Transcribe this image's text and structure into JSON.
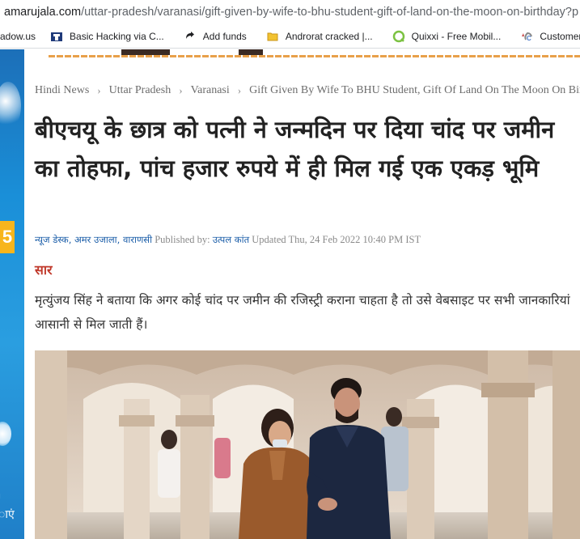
{
  "browser": {
    "url_domain": "amarujala.com",
    "url_path": "/uttar-pradesh/varanasi/gift-given-by-wife-to-bhu-student-gift-of-land-on-the-moon-on-birthday?p"
  },
  "bookmarks": [
    {
      "label": "adow.us",
      "icon": "bookmark-favicon"
    },
    {
      "label": "Basic Hacking via C...",
      "icon": "hack-favicon"
    },
    {
      "label": "Add funds",
      "icon": "add-funds-favicon"
    },
    {
      "label": "Androrat cracked |...",
      "icon": "folder-favicon"
    },
    {
      "label": "Quixxi - Free Mobil...",
      "icon": "quixxi-favicon"
    },
    {
      "label": "Customer Service",
      "icon": "customer-service-favicon"
    }
  ],
  "left_ad": {
    "badge": "5",
    "line1": "ı",
    "line2": "ाएं"
  },
  "breadcrumb": {
    "items": [
      "Hindi News",
      "Uttar Pradesh",
      "Varanasi",
      "Gift Given By Wife To BHU Student, Gift Of Land On The Moon On Birthday"
    ],
    "separator": "›"
  },
  "article": {
    "headline": "बीएचयू के छात्र को पत्नी ने जन्मदिन पर दिया चांद पर जमीन का तोहफा, पांच हजार रुपये में ही मिल गई एक एकड़ भूमि",
    "byline": {
      "desk": "न्यूज डेस्क, अमर उजाला, वाराणसी",
      "published_by_label": "Published by:",
      "author": "उत्पल कांत",
      "updated": "Updated Thu, 24 Feb 2022 10:40 PM IST"
    },
    "summary_heading": "सार",
    "summary_text": "मृत्युंजय सिंह ने बताया कि अगर कोई चांद पर जमीन की रजिस्ट्री कराना चाहता है तो उसे वेबसाइट पर सभी जानकारियां आसानी से मिल जाती हैं।"
  },
  "colors": {
    "link": "#1a5da8",
    "summary_heading": "#c0392b",
    "headline": "#222222"
  }
}
